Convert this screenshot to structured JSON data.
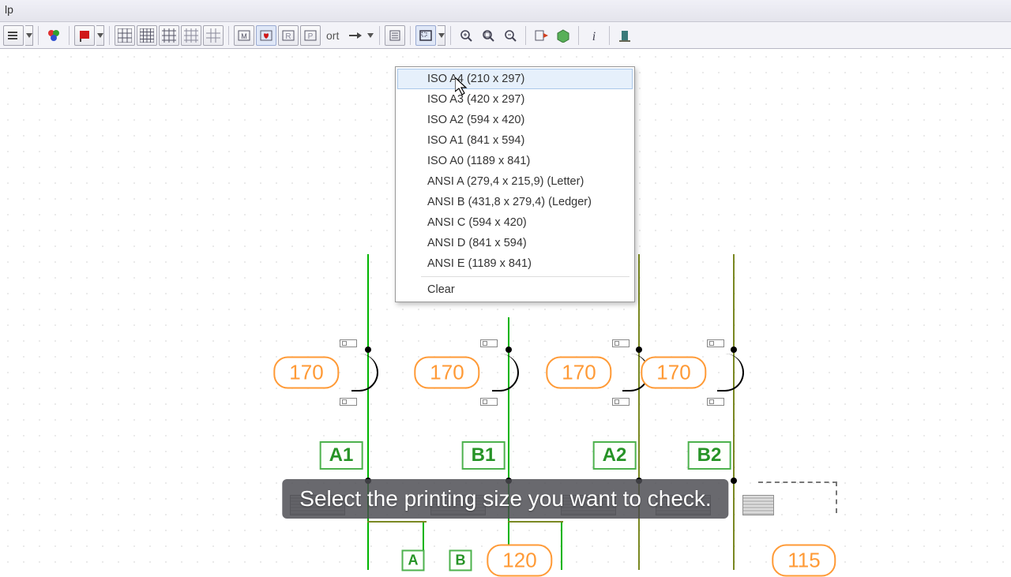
{
  "menubar": {
    "visible_item": "lp"
  },
  "toolbar": {
    "ort_label": "ort"
  },
  "dropdown": {
    "items": [
      "ISO A4 (210 x 297)",
      "ISO A3 (420 x 297)",
      "ISO A2 (594 x 420)",
      "ISO A1 (841 x 594)",
      "ISO A0 (1189 x 841)",
      "ANSI A (279,4 x 215,9) (Letter)",
      "ANSI B (431,8 x 279,4) (Ledger)",
      "ANSI C (594 x 420)",
      "ANSI D (841 x 594)",
      "ANSI E (1189 x 841)"
    ],
    "clear_label": "Clear",
    "hovered_index": 0
  },
  "components": {
    "value_labels": [
      "170",
      "170",
      "170",
      "170"
    ],
    "node_labels": [
      "A1",
      "B1",
      "A2",
      "B2"
    ],
    "bottom_values": [
      "120",
      "115"
    ],
    "bottom_small": [
      "A",
      "B"
    ]
  },
  "caption": "Select the printing size you want to check.",
  "colors": {
    "accent_orange": "#ff9a36",
    "wire_green": "#00b400",
    "wire_olive": "#7a8822"
  }
}
